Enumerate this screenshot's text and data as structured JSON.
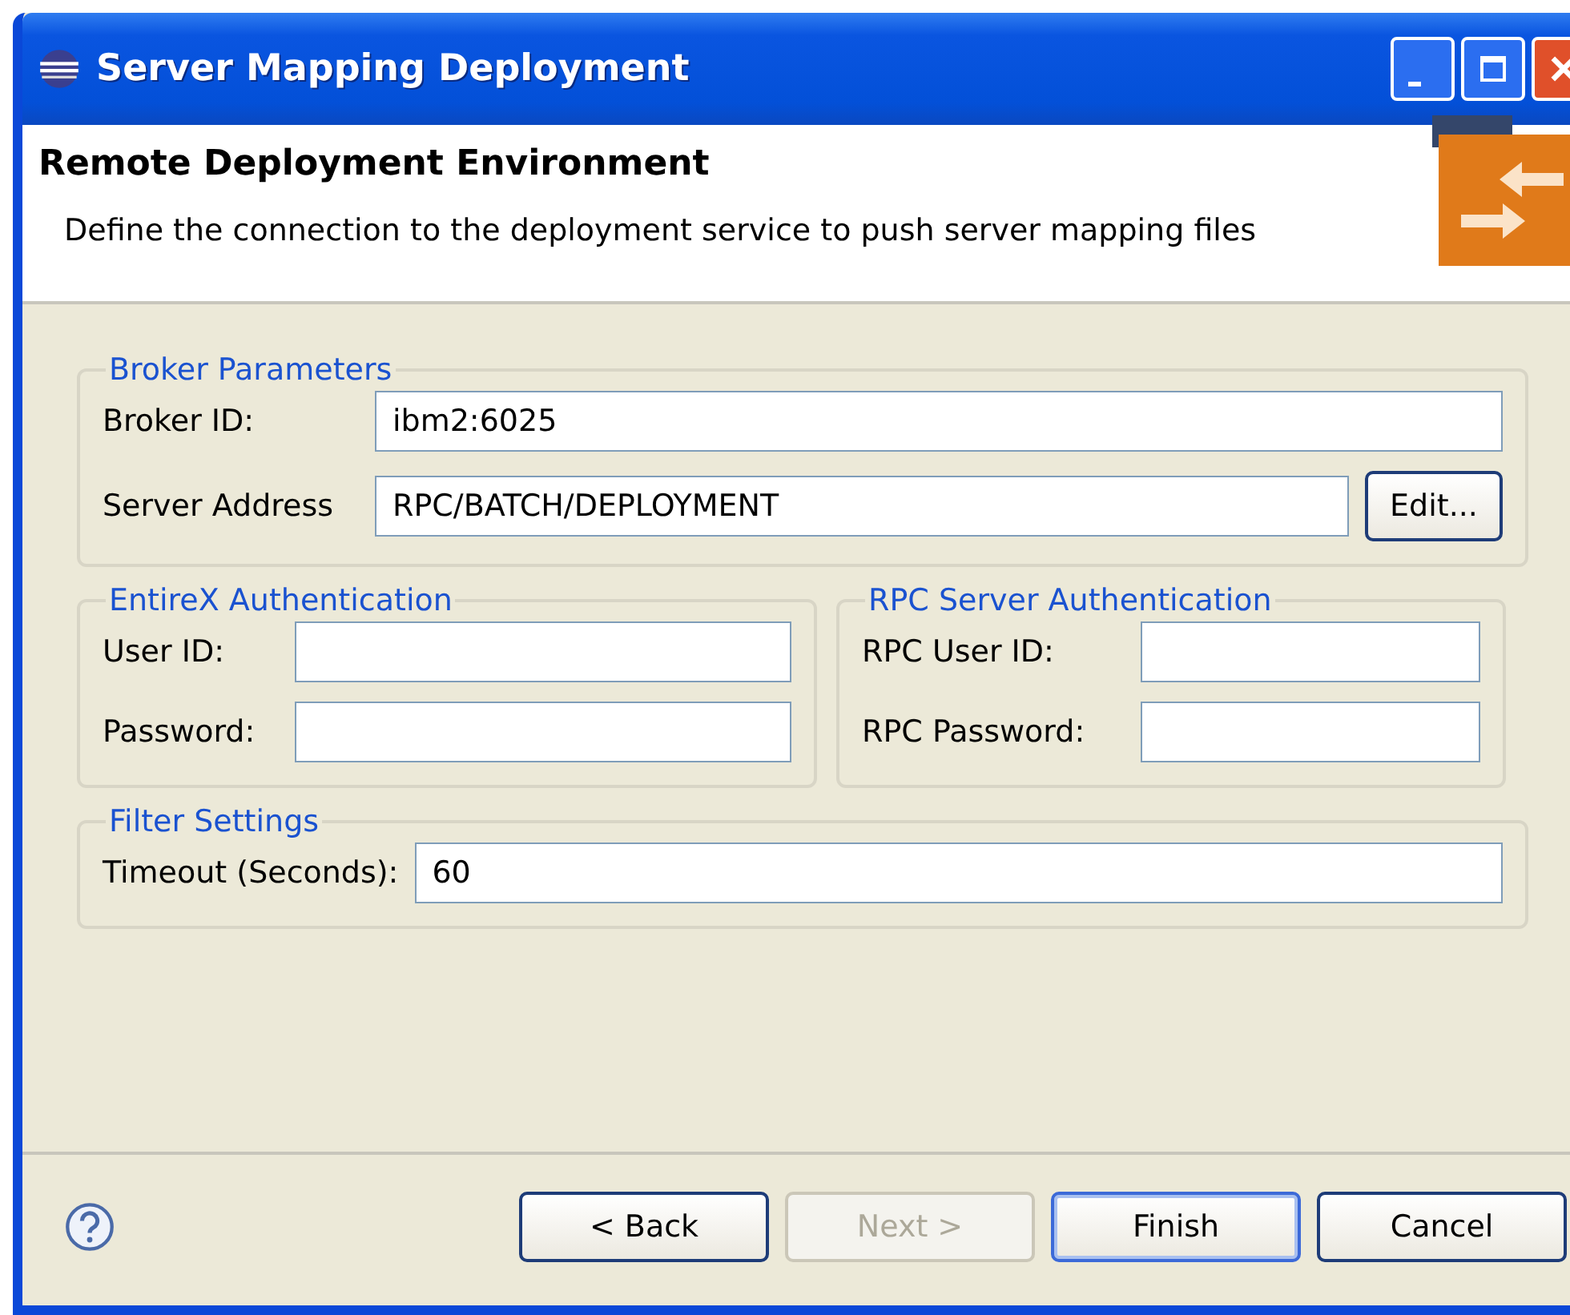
{
  "window": {
    "title": "Server Mapping Deployment"
  },
  "header": {
    "title": "Remote Deployment Environment",
    "description": "Define the connection to the deployment service to push server mapping files"
  },
  "broker": {
    "legend": "Broker Parameters",
    "fields": [
      {
        "label": "Broker ID:",
        "value": "ibm2:6025"
      },
      {
        "label": "Server Address",
        "value": "RPC/BATCH/DEPLOYMENT",
        "button": "Edit..."
      }
    ]
  },
  "authentication": [
    {
      "legend": "EntireX Authentication",
      "fields": [
        {
          "label": "User ID:"
        },
        {
          "label": "Password:"
        }
      ]
    },
    {
      "legend": "RPC Server Authentication",
      "fields": [
        {
          "label": "RPC User ID:"
        },
        {
          "label": "RPC Password:"
        }
      ]
    }
  ],
  "filter": {
    "legend": "Filter Settings",
    "fields": [
      {
        "label": "Timeout (Seconds):",
        "value": "60"
      }
    ]
  },
  "buttons": [
    {
      "label": "< Back",
      "disabled": false,
      "default": false
    },
    {
      "label": "Next >",
      "disabled": true,
      "default": false
    },
    {
      "label": "Finish",
      "disabled": false,
      "default": true
    },
    {
      "label": "Cancel",
      "disabled": false,
      "default": false
    }
  ]
}
